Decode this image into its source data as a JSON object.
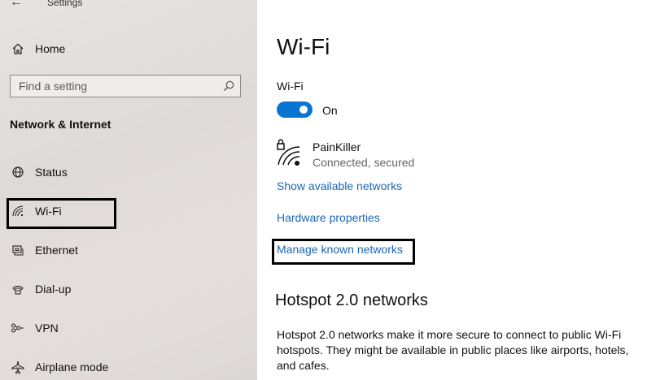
{
  "window": {
    "title": "Settings"
  },
  "sidebar": {
    "home_label": "Home",
    "search": {
      "placeholder": "Find a setting"
    },
    "section_heading": "Network & Internet",
    "items": [
      {
        "label": "Status",
        "icon": "globe-icon"
      },
      {
        "label": "Wi-Fi",
        "icon": "wifi-icon",
        "selected": true
      },
      {
        "label": "Ethernet",
        "icon": "ethernet-icon"
      },
      {
        "label": "Dial-up",
        "icon": "dial-up-icon"
      },
      {
        "label": "VPN",
        "icon": "vpn-icon"
      },
      {
        "label": "Airplane mode",
        "icon": "airplane-icon"
      }
    ]
  },
  "main": {
    "title": "Wi-Fi",
    "wifi_label": "Wi-Fi",
    "toggle_state": "On",
    "network": {
      "name": "PainKiller",
      "status": "Connected, secured"
    },
    "links": {
      "show_networks": "Show available networks",
      "hardware": "Hardware properties",
      "manage": "Manage known networks"
    },
    "hotspot": {
      "title": "Hotspot 2.0 networks",
      "description": "Hotspot 2.0 networks make it more secure to connect to public Wi-Fi hotspots. They might be available in public places like airports, hotels, and cafes."
    }
  },
  "colors": {
    "accent": "#0a74d2",
    "link": "#1a66b3",
    "annotation_box": "#000000"
  }
}
